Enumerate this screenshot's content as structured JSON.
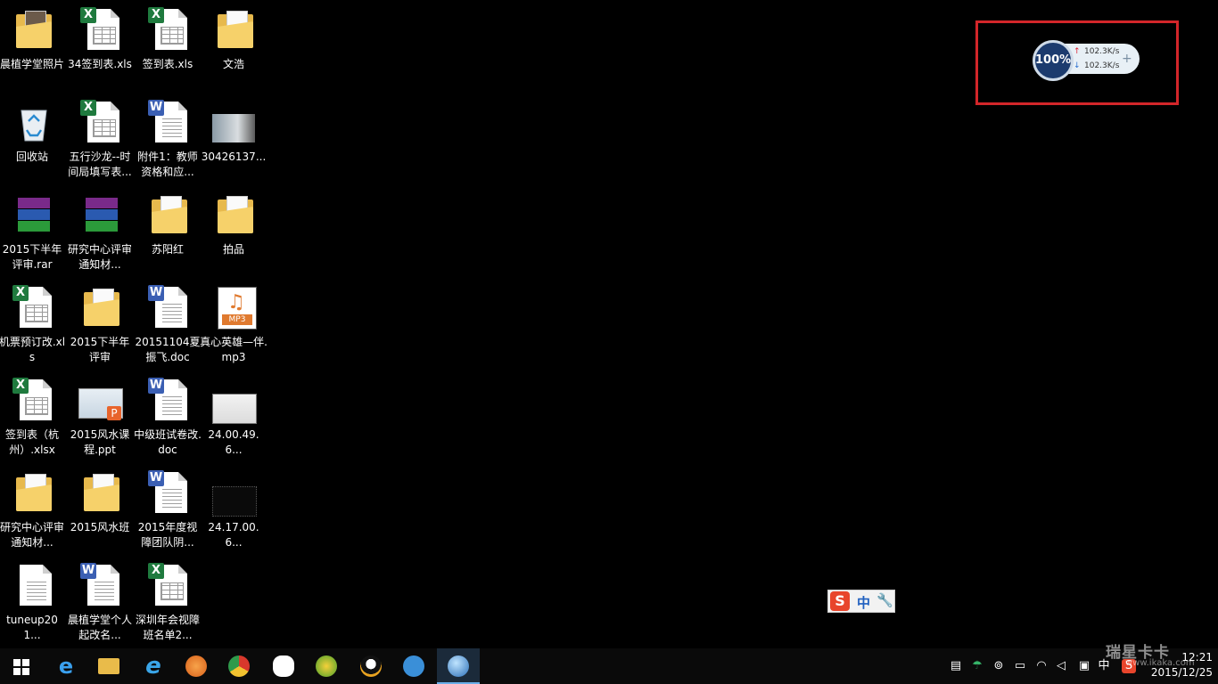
{
  "desktop_icons": [
    {
      "label": "晨植学堂照片"
    },
    {
      "label": "34签到表.xls"
    },
    {
      "label": "签到表.xls"
    },
    {
      "label": "文浩"
    },
    {
      "label": "回收站"
    },
    {
      "label": "五行沙龙--时间局填写表..."
    },
    {
      "label": "附件1：教师资格和应..."
    },
    {
      "label": "30426137..."
    },
    {
      "label": "2015下半年评审.rar"
    },
    {
      "label": "研究中心评审通知材..."
    },
    {
      "label": "苏阳红"
    },
    {
      "label": "拍品"
    },
    {
      "label": "机票预订改.xls"
    },
    {
      "label": "2015下半年评审"
    },
    {
      "label": "20151104夏振飞.doc"
    },
    {
      "label": "真心英雄—伴.mp3"
    },
    {
      "label": "签到表（杭州）.xlsx"
    },
    {
      "label": "2015风水课程.ppt"
    },
    {
      "label": "中级班试卷改.doc"
    },
    {
      "label": "24.00.49.6..."
    },
    {
      "label": "研究中心评审通知材..."
    },
    {
      "label": "2015风水班"
    },
    {
      "label": "2015年度视障团队阴..."
    },
    {
      "label": "24.17.00.6..."
    },
    {
      "label": "tuneup201..."
    },
    {
      "label": "晨植学堂个人起改名..."
    },
    {
      "label": "深圳年会视障班名单2..."
    }
  ],
  "speed_widget": {
    "percent": "100%",
    "upload": "102.3K/s",
    "download": "102.3K/s",
    "plus": "+"
  },
  "ime_bar": {
    "logo": "S",
    "mode": "中",
    "tool": "🔧"
  },
  "taskbar": {
    "tray_lang": "中",
    "time": "12:21",
    "date": "2015/12/25"
  },
  "watermark": {
    "text": "瑞星卡卡",
    "url": "www.ikaka.com"
  }
}
